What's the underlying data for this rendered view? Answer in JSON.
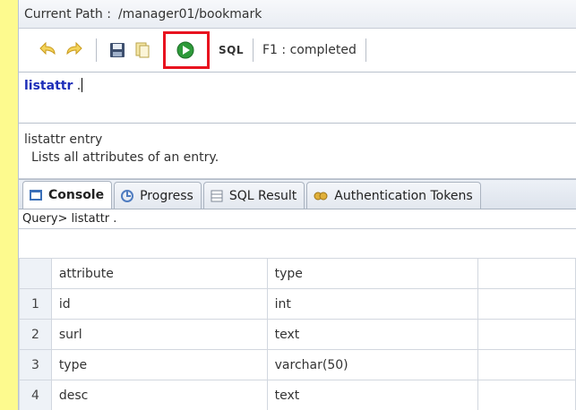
{
  "path": {
    "label": "Current Path :",
    "value": "/manager01/bookmark"
  },
  "toolbar": {
    "sql_label": "SQL",
    "status": "F1 : completed",
    "buttons": [
      "undo-icon",
      "redo-icon",
      "save-icon",
      "copy-icon",
      "run-icon"
    ],
    "highlight_color": "#e8131f",
    "run_color": "#2e9a3a"
  },
  "editor": {
    "keyword": "listattr",
    "rest": " ."
  },
  "help": {
    "title": "listattr entry",
    "description": "Lists all attributes of an entry."
  },
  "tabs": [
    {
      "label": "Console",
      "icon": "console-icon",
      "active": true
    },
    {
      "label": "Progress",
      "icon": "progress-icon",
      "active": false
    },
    {
      "label": "SQL Result",
      "icon": "table-icon",
      "active": false
    },
    {
      "label": "Authentication Tokens",
      "icon": "tokens-icon",
      "active": false
    }
  ],
  "query": "Query> listattr .",
  "table": {
    "columns": [
      "attribute",
      "type"
    ],
    "rows": [
      {
        "n": "1",
        "attribute": "id",
        "type": "int"
      },
      {
        "n": "2",
        "attribute": "surl",
        "type": "text"
      },
      {
        "n": "3",
        "attribute": "type",
        "type": "varchar(50)"
      },
      {
        "n": "4",
        "attribute": "desc",
        "type": "text"
      }
    ]
  }
}
